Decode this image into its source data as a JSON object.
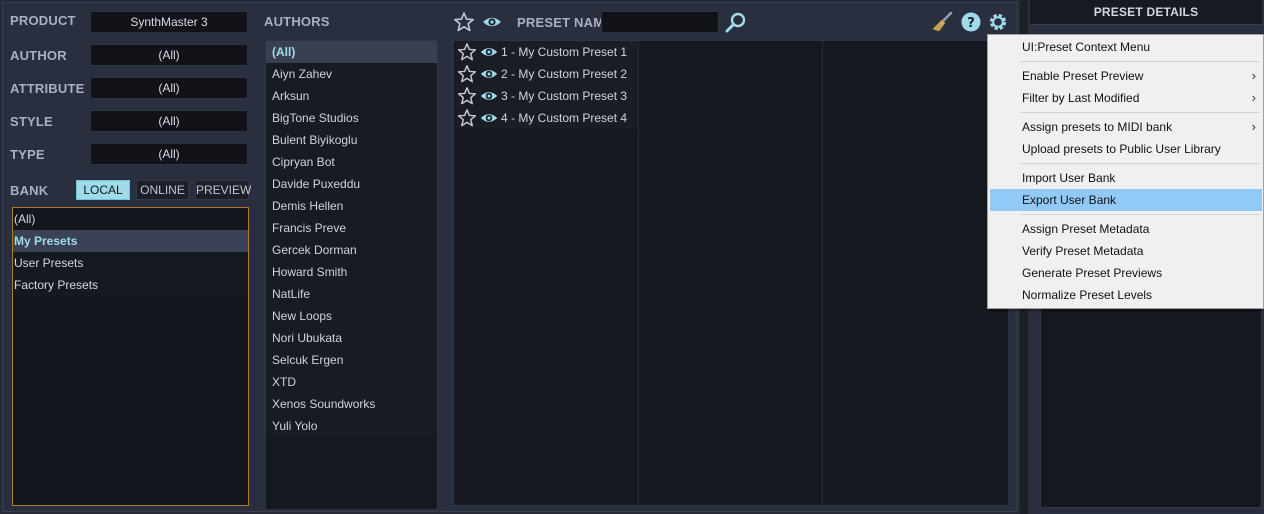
{
  "filters": {
    "product": {
      "label": "PRODUCT",
      "value": "SynthMaster 3"
    },
    "author": {
      "label": "AUTHOR",
      "value": "(All)"
    },
    "attribute": {
      "label": "ATTRIBUTE",
      "value": "(All)"
    },
    "style": {
      "label": "STYLE",
      "value": "(All)"
    },
    "type": {
      "label": "TYPE",
      "value": "(All)"
    }
  },
  "bank": {
    "label": "BANK",
    "buttons": [
      "LOCAL",
      "ONLINE",
      "PREVIEW"
    ],
    "items": [
      "(All)",
      "My Presets",
      "User Presets",
      "Factory Presets"
    ]
  },
  "authors": {
    "label": "AUTHORS",
    "items": [
      "(All)",
      "Aiyn Zahev",
      "Arksun",
      "BigTone Studios",
      "Bulent Biyikoglu",
      "Cipryan Bot",
      "Davide Puxeddu",
      "Demis Hellen",
      "Francis Preve",
      "Gercek Dorman",
      "Howard Smith",
      "NatLife",
      "New Loops",
      "Nori Ubukata",
      "Selcuk Ergen",
      "XTD",
      "Xenos Soundworks",
      "Yuli Yolo"
    ]
  },
  "presets": {
    "label": "PRESET NAME",
    "search_value": "",
    "items": [
      "1 - My Custom Preset 1",
      "2 - My Custom Preset 2",
      "3 - My Custom Preset 3",
      "4 - My Custom Preset 4"
    ]
  },
  "details": {
    "label": "PRESET DETAILS"
  },
  "context_menu": {
    "items": [
      {
        "label": "UI:Preset Context Menu",
        "submenu": false
      },
      {
        "label": "Enable Preset Preview",
        "submenu": true
      },
      {
        "label": "Filter by Last Modified",
        "submenu": true
      },
      {
        "label": "Assign presets to MIDI bank",
        "submenu": true
      },
      {
        "label": "Upload presets to Public User Library",
        "submenu": false
      },
      {
        "label": "Import User Bank",
        "submenu": false
      },
      {
        "label": "Export User Bank",
        "submenu": false
      },
      {
        "label": "Assign Preset Metadata",
        "submenu": false
      },
      {
        "label": "Verify Preset Metadata",
        "submenu": false
      },
      {
        "label": "Generate Preset Previews",
        "submenu": false
      },
      {
        "label": "Normalize Preset Levels",
        "submenu": false
      }
    ],
    "arrow": "›"
  },
  "icons": {
    "favorites": "star-icon",
    "preview": "eye-icon",
    "search": "magnifier-icon",
    "clear": "broom-icon",
    "help": "help-icon",
    "settings": "gear-icon"
  },
  "colors": {
    "accent": "#9fdbe9",
    "bank_border": "#b07a2c",
    "menu_highlight": "#91c9f7"
  }
}
